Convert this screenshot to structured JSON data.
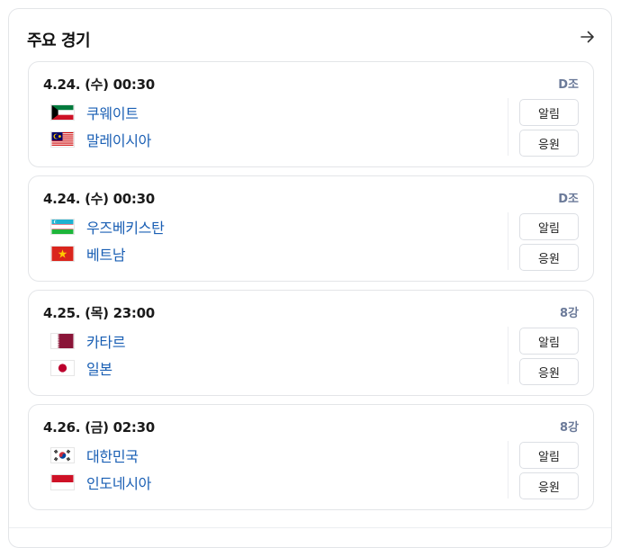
{
  "header": {
    "title": "주요 경기"
  },
  "buttons": {
    "alarm_label": "알림",
    "cheer_label": "응원"
  },
  "matches": [
    {
      "datetime": "4.24. (수) 00:30",
      "stage": "D조",
      "team1": {
        "name": "쿠웨이트",
        "flag": "kuwait-flag-icon"
      },
      "team2": {
        "name": "말레이시아",
        "flag": "malaysia-flag-icon"
      }
    },
    {
      "datetime": "4.24. (수) 00:30",
      "stage": "D조",
      "team1": {
        "name": "우즈베키스탄",
        "flag": "uzbekistan-flag-icon"
      },
      "team2": {
        "name": "베트남",
        "flag": "vietnam-flag-icon"
      }
    },
    {
      "datetime": "4.25. (목) 23:00",
      "stage": "8강",
      "team1": {
        "name": "카타르",
        "flag": "qatar-flag-icon"
      },
      "team2": {
        "name": "일본",
        "flag": "japan-flag-icon"
      }
    },
    {
      "datetime": "4.26. (금) 02:30",
      "stage": "8강",
      "team1": {
        "name": "대한민국",
        "flag": "south-korea-flag-icon"
      },
      "team2": {
        "name": "인도네시아",
        "flag": "indonesia-flag-icon"
      }
    }
  ],
  "colors": {
    "team_link": "#1a5fb4",
    "stage_label": "#6b7a99",
    "border": "#e3e5e8"
  }
}
